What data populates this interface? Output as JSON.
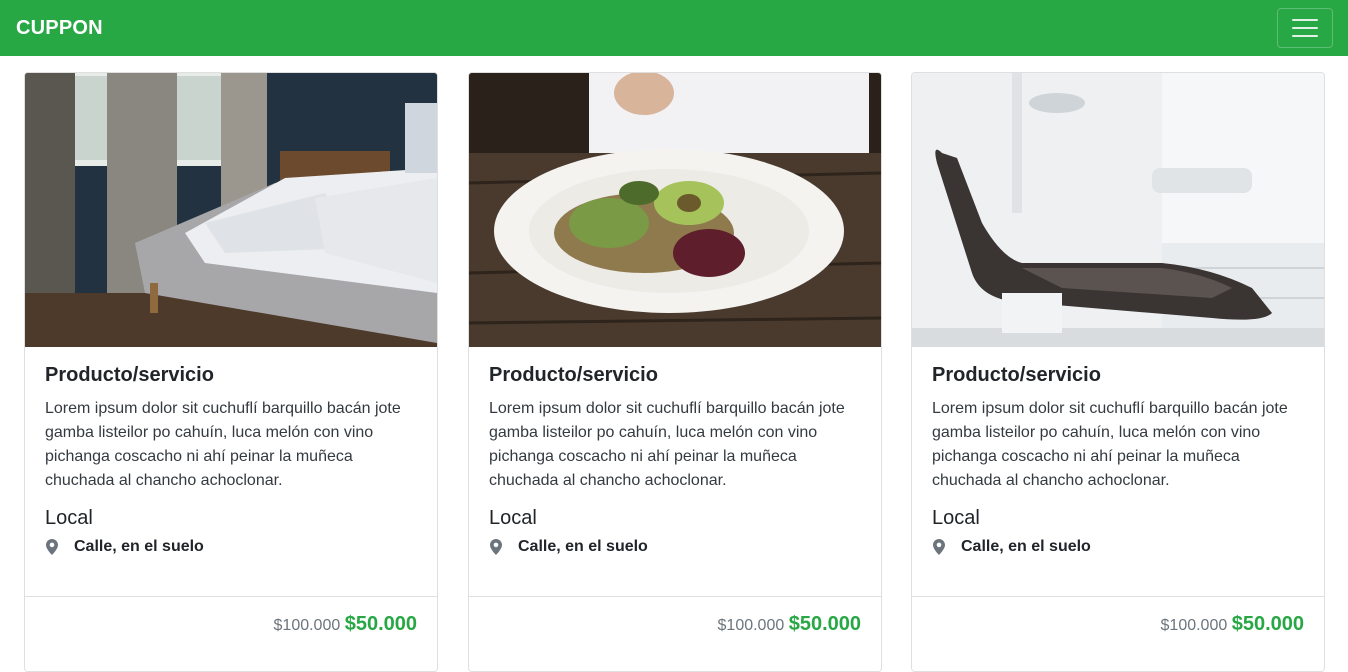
{
  "navbar": {
    "brand": "CUPPON",
    "toggle_icon": "hamburger-menu-icon",
    "color": "#28a745"
  },
  "cards": [
    {
      "image": "bedroom-photo",
      "title": "Producto/servicio",
      "description": "Lorem ipsum dolor sit cuchuflí barquillo bacán jote gamba listeilor po cahuín, luca melón con vino pichanga coscacho ni ahí peinar la muñeca chuchada al chancho achoclonar.",
      "local_label": "Local",
      "address_icon": "map-marker-icon",
      "address": "Calle, en el suelo",
      "old_price": "$100.000",
      "new_price": "$50.000"
    },
    {
      "image": "salad-plate-photo",
      "title": "Producto/servicio",
      "description": "Lorem ipsum dolor sit cuchuflí barquillo bacán jote gamba listeilor po cahuín, luca melón con vino pichanga coscacho ni ahí peinar la muñeca chuchada al chancho achoclonar.",
      "local_label": "Local",
      "address_icon": "map-marker-icon",
      "address": "Calle, en el suelo",
      "old_price": "$100.000",
      "new_price": "$50.000"
    },
    {
      "image": "dental-chair-photo",
      "title": "Producto/servicio",
      "description": "Lorem ipsum dolor sit cuchuflí barquillo bacán jote gamba listeilor po cahuín, luca melón con vino pichanga coscacho ni ahí peinar la muñeca chuchada al chancho achoclonar.",
      "local_label": "Local",
      "address_icon": "map-marker-icon",
      "address": "Calle, en el suelo",
      "old_price": "$100.000",
      "new_price": "$50.000"
    }
  ]
}
